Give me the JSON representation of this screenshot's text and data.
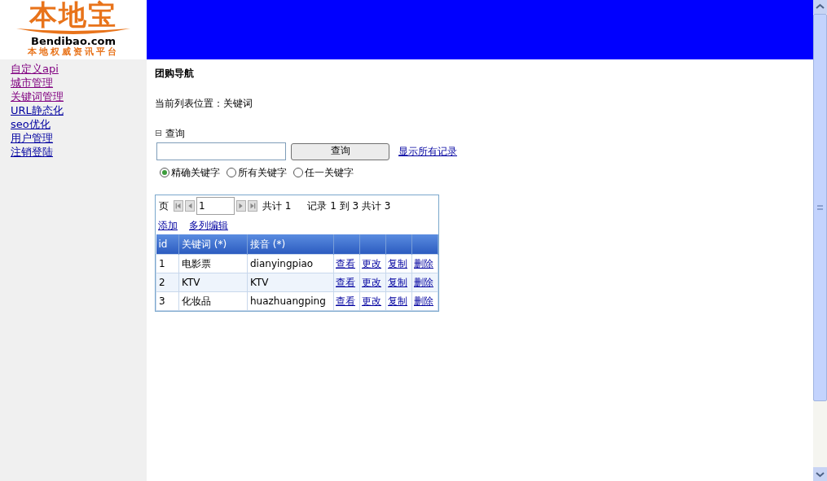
{
  "logo": {
    "title": "本地宝",
    "domain": "Bendibao.com",
    "tagline": "本地权威资讯平台"
  },
  "sidebar": {
    "items": [
      {
        "label": "自定义api",
        "visited": true
      },
      {
        "label": "城市管理",
        "visited": true
      },
      {
        "label": "关键词管理",
        "visited": true
      },
      {
        "label": "URL静态化",
        "visited": false
      },
      {
        "label": "seo优化",
        "visited": false
      },
      {
        "label": "用户管理",
        "visited": false
      },
      {
        "label": "注销登陆",
        "visited": false
      }
    ]
  },
  "page_title": "团购导航",
  "location": "当前列表位置：关键词",
  "query": {
    "toggle": "⊟",
    "title": "查询",
    "button": "查询",
    "show_all": "显示所有记录",
    "options": [
      {
        "label": "精确关键字",
        "selected": true
      },
      {
        "label": "所有关键字",
        "selected": false
      },
      {
        "label": "任一关键字",
        "selected": false
      }
    ]
  },
  "pager": {
    "page_label": "页",
    "page": "1",
    "total_pages": "共计 1",
    "records": "记录 1 到 3 共计 3"
  },
  "table_links": [
    "添加",
    "多列编辑"
  ],
  "table": {
    "columns": [
      "id",
      "关键词 (*)",
      "接音 (*)"
    ],
    "rows": [
      {
        "cells": [
          "1",
          "电影票",
          "dianyingpiao"
        ],
        "actions": [
          "查看",
          "更改",
          "复制",
          "删除"
        ]
      },
      {
        "cells": [
          "2",
          "KTV",
          "KTV"
        ],
        "actions": [
          "查看",
          "更改",
          "复制",
          "删除"
        ]
      },
      {
        "cells": [
          "3",
          "化妆品",
          "huazhuangping"
        ],
        "actions": [
          "查看",
          "更改",
          "复制",
          "删除"
        ]
      }
    ]
  }
}
